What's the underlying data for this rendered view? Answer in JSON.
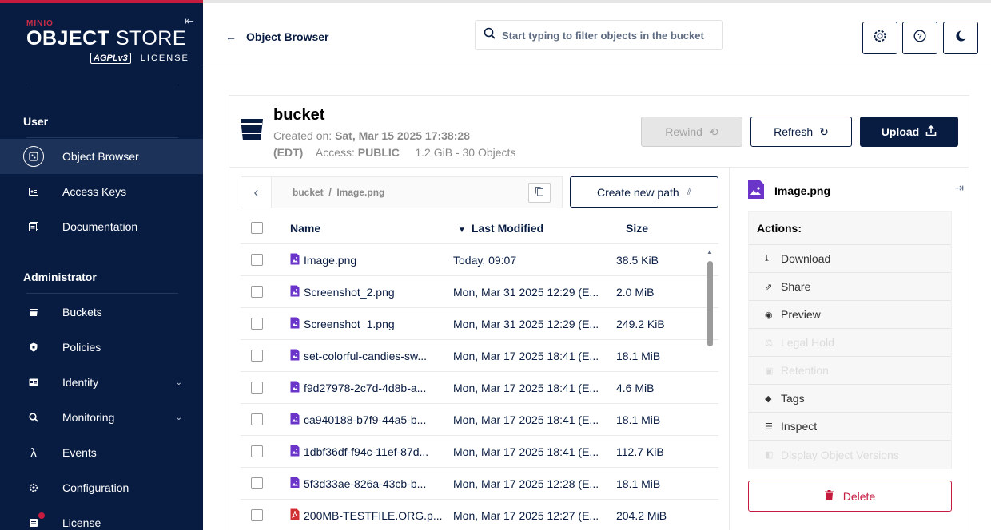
{
  "brand": {
    "minio": "MINIO",
    "object": "OBJECT",
    "store": " STORE",
    "agpl": "AGPLv3",
    "license": "LICENSE"
  },
  "sidebar": {
    "user_section": "User",
    "admin_section": "Administrator",
    "user_items": [
      {
        "label": "Object Browser",
        "icon": "object-browser-icon",
        "active": true
      },
      {
        "label": "Access Keys",
        "icon": "access-keys-icon"
      },
      {
        "label": "Documentation",
        "icon": "documentation-icon"
      }
    ],
    "admin_items": [
      {
        "label": "Buckets",
        "icon": "bucket-icon"
      },
      {
        "label": "Policies",
        "icon": "policies-icon"
      },
      {
        "label": "Identity",
        "icon": "identity-icon",
        "expandable": true
      },
      {
        "label": "Monitoring",
        "icon": "monitoring-icon",
        "expandable": true
      },
      {
        "label": "Events",
        "icon": "lambda-icon"
      },
      {
        "label": "Configuration",
        "icon": "gear-icon"
      },
      {
        "label": "License",
        "icon": "license-icon"
      }
    ]
  },
  "header": {
    "back_label": "Object Browser",
    "search_placeholder": "Start typing to filter objects in the bucket"
  },
  "bucket": {
    "name": "bucket",
    "created_label": "Created on: ",
    "created_value": "Sat, Mar 15 2025 17:38:28",
    "tz": "(EDT)",
    "access_label": "Access: ",
    "access_value": "PUBLIC",
    "summary": "1.2 GiB - 30 Objects"
  },
  "toolbar": {
    "rewind": "Rewind",
    "refresh": "Refresh",
    "upload": "Upload"
  },
  "breadcrumb": {
    "path": "bucket  /  Image.png"
  },
  "create_path": "Create new path",
  "table": {
    "headers": {
      "name": "Name",
      "modified": "Last Modified",
      "size": "Size"
    },
    "rows": [
      {
        "name": "Image.png",
        "modified": "Today, 09:07",
        "size": "38.5 KiB",
        "type": "image"
      },
      {
        "name": "Screenshot_2.png",
        "modified": "Mon, Mar 31 2025 12:29 (E...",
        "size": "2.0 MiB",
        "type": "image"
      },
      {
        "name": "Screenshot_1.png",
        "modified": "Mon, Mar 31 2025 12:29 (E...",
        "size": "249.2 KiB",
        "type": "image"
      },
      {
        "name": "set-colorful-candies-sw...",
        "modified": "Mon, Mar 17 2025 18:41 (E...",
        "size": "18.1 MiB",
        "type": "image"
      },
      {
        "name": "f9d27978-2c7d-4d8b-a...",
        "modified": "Mon, Mar 17 2025 18:41 (E...",
        "size": "4.6 MiB",
        "type": "image"
      },
      {
        "name": "ca940188-b7f9-44a5-b...",
        "modified": "Mon, Mar 17 2025 18:41 (E...",
        "size": "18.1 MiB",
        "type": "image"
      },
      {
        "name": "1dbf36df-f94c-11ef-87d...",
        "modified": "Mon, Mar 17 2025 18:41 (E...",
        "size": "112.7 KiB",
        "type": "image"
      },
      {
        "name": "5f3d33ae-826a-43cb-b...",
        "modified": "Mon, Mar 17 2025 12:28 (E...",
        "size": "18.1 MiB",
        "type": "image"
      },
      {
        "name": "200MB-TESTFILE.ORG.p...",
        "modified": "Mon, Mar 17 2025 12:27 (E...",
        "size": "204.2 MiB",
        "type": "pdf"
      }
    ]
  },
  "detail": {
    "filename": "Image.png",
    "actions_title": "Actions:",
    "actions": [
      {
        "label": "Download",
        "icon": "download-icon",
        "enabled": true
      },
      {
        "label": "Share",
        "icon": "share-icon",
        "enabled": true
      },
      {
        "label": "Preview",
        "icon": "eye-icon",
        "enabled": true
      },
      {
        "label": "Legal Hold",
        "icon": "legal-hold-icon",
        "enabled": false
      },
      {
        "label": "Retention",
        "icon": "retention-icon",
        "enabled": false
      },
      {
        "label": "Tags",
        "icon": "tag-icon",
        "enabled": true
      },
      {
        "label": "Inspect",
        "icon": "inspect-icon",
        "enabled": true
      },
      {
        "label": "Display Object Versions",
        "icon": "versions-icon",
        "enabled": false
      }
    ],
    "delete": "Delete"
  },
  "colors": {
    "navy": "#081c42",
    "accent_red": "#c51b3f",
    "file_icon_purple": "#6b35c9",
    "pdf_icon_red": "#d03030"
  }
}
